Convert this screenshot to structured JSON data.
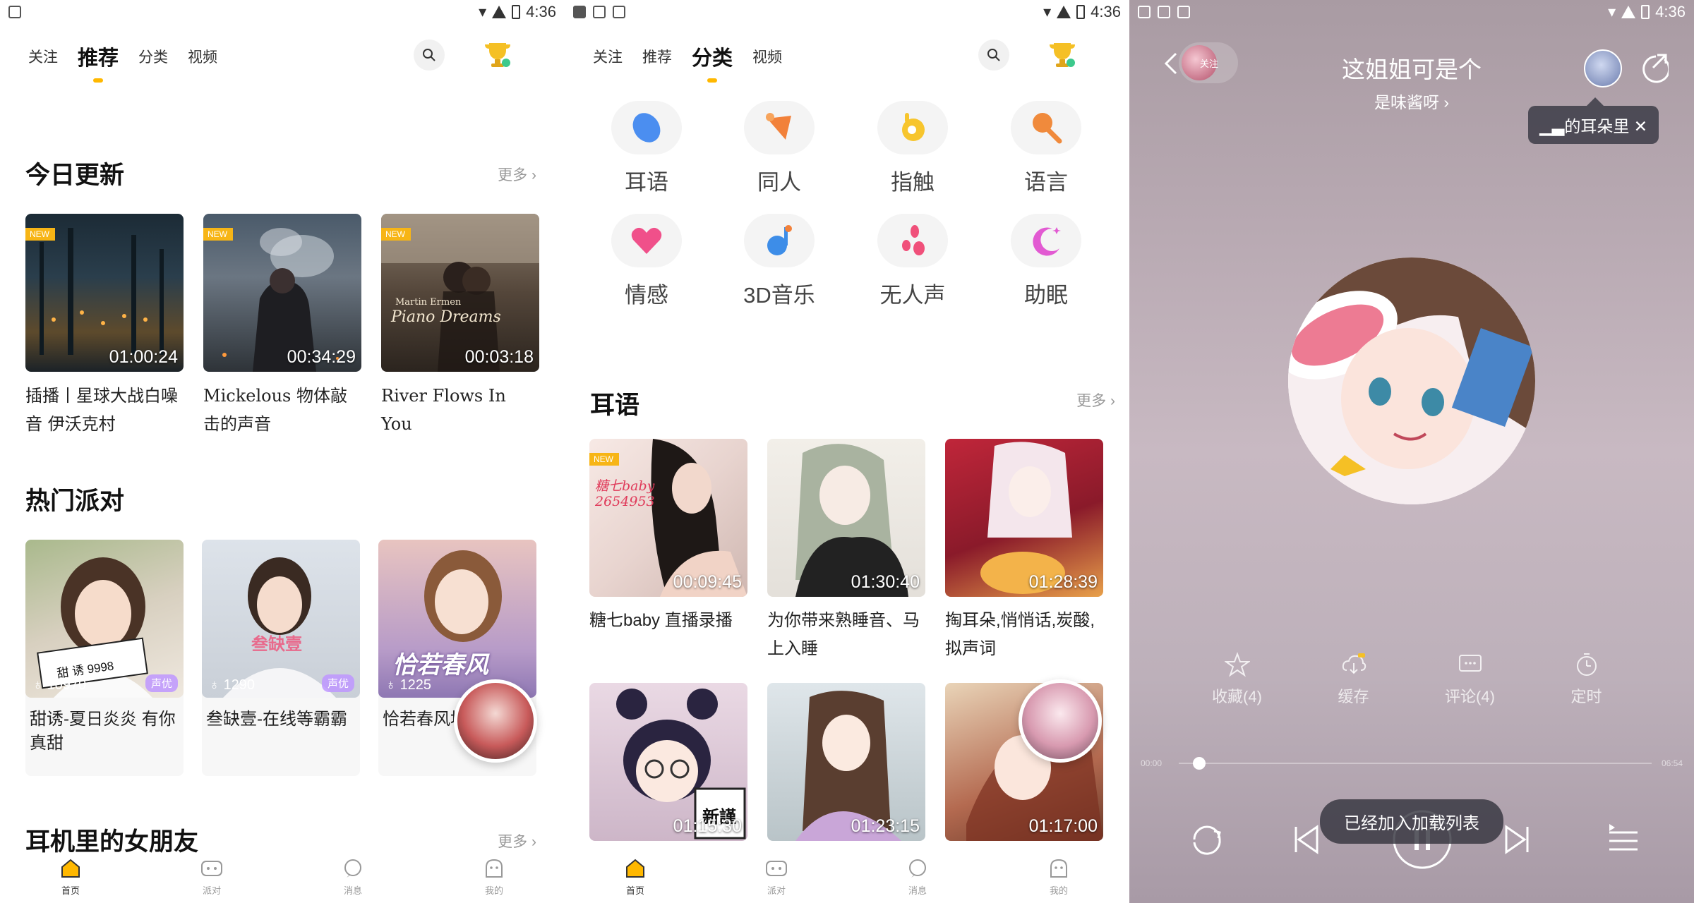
{
  "status": {
    "time": "4:36"
  },
  "home": {
    "tabs": [
      "关注",
      "推荐",
      "分类",
      "视频"
    ],
    "today": {
      "title": "今日更新",
      "more": "更多",
      "items": [
        {
          "badge": "NEW",
          "duration": "01:00:24",
          "title": "插播丨星球大战白噪音 伊沃克村"
        },
        {
          "badge": "NEW",
          "duration": "00:34:29",
          "title": "Mickelous 物体敲击的声音"
        },
        {
          "badge": "NEW",
          "duration": "00:03:18",
          "title": "River Flows In You",
          "art_text_1": "Martin Ermen",
          "art_text_2": "Piano Dreams"
        }
      ]
    },
    "party": {
      "title": "热门派对",
      "items": [
        {
          "count": "10970",
          "tag": "声优",
          "title": "甜诱-夏日炎炎 有你真甜",
          "art_text": "甜 诱 9998"
        },
        {
          "count": "1290",
          "tag": "声优",
          "title": "叁缺壹-在线等霸霸",
          "art_text": "叁缺壹"
        },
        {
          "count": "1225",
          "title": "恰若春风地",
          "art_text": "恰若春风"
        }
      ]
    },
    "girlfriend": {
      "title": "耳机里的女朋友",
      "more": "更多"
    }
  },
  "bottom_nav": [
    "首页",
    "派对",
    "消息",
    "我的"
  ],
  "category": {
    "tabs": [
      "关注",
      "推荐",
      "分类",
      "视频"
    ],
    "cats": [
      {
        "label": "耳语",
        "color": "#4b8ef0"
      },
      {
        "label": "同人",
        "color": "#f2813a"
      },
      {
        "label": "指触",
        "color": "#f7c52d"
      },
      {
        "label": "语言",
        "color": "#f08a3c"
      },
      {
        "label": "情感",
        "color": "#f0508a"
      },
      {
        "label": "3D音乐",
        "color": "#3d8de8"
      },
      {
        "label": "无人声",
        "color": "#f0507a"
      },
      {
        "label": "助眠",
        "color": "#e25ad2"
      }
    ],
    "whisper": {
      "title": "耳语",
      "more": "更多",
      "items": [
        {
          "badge": "NEW",
          "duration": "00:09:45",
          "title": "糖七baby 直播录播",
          "art_text": "糖七baby 2654953"
        },
        {
          "duration": "01:30:40",
          "title": "为你带来熟睡音、马上入睡"
        },
        {
          "duration": "01:28:39",
          "title": "掏耳朵,悄悄话,炭酸,拟声词"
        },
        {
          "duration": "01:15:30",
          "art_text": "新謹"
        },
        {
          "duration": "01:23:15"
        },
        {
          "duration": "01:17:00"
        }
      ]
    }
  },
  "player": {
    "follow": "关注",
    "title": "这姐姐可是个",
    "artist": "是味酱呀",
    "tooltip": "的耳朵里",
    "actions": [
      {
        "icon": "star-icon",
        "label": "收藏(4)"
      },
      {
        "icon": "download-icon",
        "label": "缓存"
      },
      {
        "icon": "comment-icon",
        "label": "评论(4)"
      },
      {
        "icon": "timer-icon",
        "label": "定时"
      }
    ],
    "time_current": "00:00",
    "time_total": "06:54",
    "progress": 0.03,
    "toast": "已经加入加载列表"
  }
}
